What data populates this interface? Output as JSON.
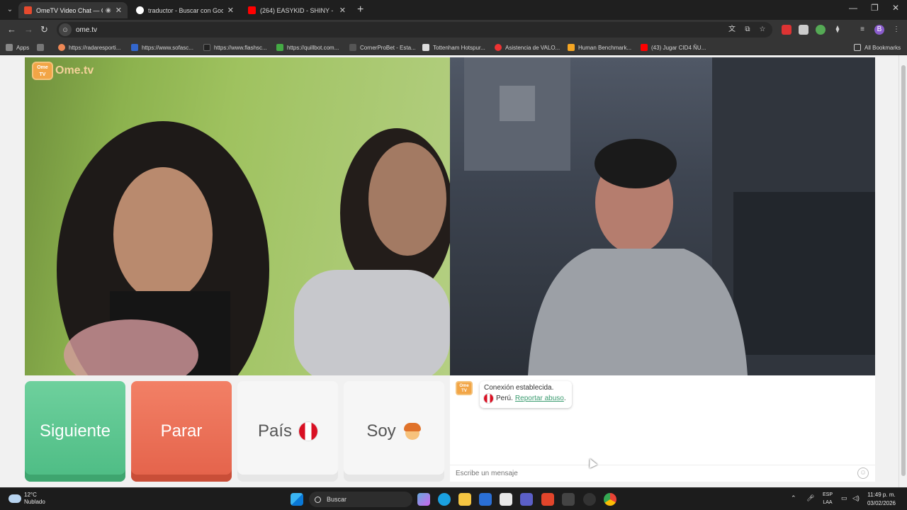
{
  "browser": {
    "tabs": [
      {
        "label": "OmeTV Video Chat — Ome",
        "active": true,
        "favicon_color": "#e64a2e"
      },
      {
        "label": "traductor - Buscar con Google",
        "active": false,
        "favicon_color": "#ffffff"
      },
      {
        "label": "(264) EASYKID - SHINY - YouTu",
        "active": false,
        "favicon_color": "#ff0000"
      }
    ],
    "url": "ome.tv",
    "profile_initial": "B",
    "bookmarks": [
      {
        "label": "Apps",
        "icon": "apps-grid-icon"
      },
      {
        "label": "https://radaresporti...",
        "icon": "site-icon"
      },
      {
        "label": "https://www.sofasc...",
        "icon": "site-icon"
      },
      {
        "label": "https://www.flashsc...",
        "icon": "site-icon"
      },
      {
        "label": "https://quillbot.com...",
        "icon": "site-icon"
      },
      {
        "label": "CornerProBet - Esta...",
        "icon": "site-icon"
      },
      {
        "label": "Tottenham Hotspur...",
        "icon": "site-icon"
      },
      {
        "label": "Asistencia de VALO...",
        "icon": "site-icon"
      },
      {
        "label": "Human Benchmark...",
        "icon": "site-icon"
      },
      {
        "label": "(43) Jugar CID4 ÑU...",
        "icon": "youtube-icon"
      }
    ],
    "all_bookmarks": "All Bookmarks"
  },
  "page": {
    "logo_text": "Ome.tv",
    "logo_badge": "Ome TV",
    "buttons": {
      "next": "Siguiente",
      "stop": "Parar",
      "country": "País",
      "gender": "Soy"
    },
    "chat": {
      "message_line1": "Conexión establecida.",
      "country": "Perú.",
      "report": "Reportar abuso",
      "report_suffix": ".",
      "input_placeholder": "Escribe un mensaje"
    }
  },
  "taskbar": {
    "temperature": "12°C",
    "weather": "Nublado",
    "search_label": "Buscar",
    "lang_line1": "ESP",
    "lang_line2": "LAA",
    "time": "11:49 p. m.",
    "date": "03/02/2026"
  },
  "colors": {
    "next_green": "#5ec490",
    "stop_red": "#ea6d54",
    "accent_link": "#3a9b6f"
  }
}
